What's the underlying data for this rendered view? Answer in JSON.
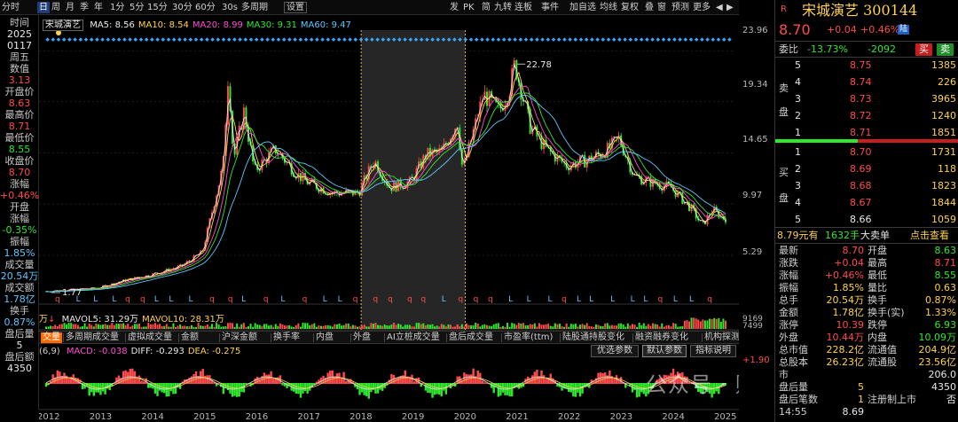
{
  "toolbar": {
    "left_items": [
      "分时",
      "日",
      "周",
      "月",
      "季",
      "年",
      "1分",
      "5分",
      "15分",
      "30分",
      "60分",
      "30s",
      "多周期",
      "设置"
    ],
    "active": "日",
    "right_items": [
      "发",
      "PK",
      "简",
      "九转",
      "连板",
      "事件",
      "加自选",
      "均线",
      "复权",
      "叠",
      "窗",
      "预测",
      "更多",
      "◀",
      "▶"
    ]
  },
  "readout": {
    "rows": [
      {
        "label": "时间",
        "value": "2025"
      },
      {
        "label": "",
        "value": "0117"
      },
      {
        "label": "周五",
        "value": ""
      },
      {
        "label": "数值",
        "value": "3.13"
      },
      {
        "label": "开盘价",
        "value": "8.63"
      },
      {
        "label": "最高价",
        "value": "8.71"
      },
      {
        "label": "最低价",
        "value": "8.55"
      },
      {
        "label": "收盘价",
        "value": "8.70"
      },
      {
        "label": "涨幅",
        "value": "+0.46%"
      },
      {
        "label": "开盘",
        "value": ""
      },
      {
        "label": "涨幅",
        "value": "-0.35%"
      },
      {
        "label": "振幅",
        "value": "1.85%"
      },
      {
        "label": "成交量",
        "value": "20.54万"
      },
      {
        "label": "成交额",
        "value": "1.78亿"
      },
      {
        "label": "换手",
        "value": "0.87%"
      },
      {
        "label": "盘后量",
        "value": "5"
      },
      {
        "label": "盘后额",
        "value": "4350"
      }
    ]
  },
  "stock": {
    "name": "宋城演艺",
    "tag": "宋城演艺",
    "code": "300144",
    "price": "8.70",
    "change": "+0.04",
    "pct": "+0.46%",
    "badge": "陆",
    "flag": "R"
  },
  "ma_legend": [
    {
      "name": "MA5: 8.56",
      "color": "#e8e8e8"
    },
    {
      "name": "MA10: 8.54",
      "color": "#ffd24a"
    },
    {
      "name": "MA20: 8.99",
      "color": "#ff4bd2"
    },
    {
      "name": "MA30: 9.31",
      "color": "#2ee82e"
    },
    {
      "name": "MA60: 9.47",
      "color": "#5ec8ff"
    }
  ],
  "volume_legend": [
    {
      "name": "MAVOL5: 31.29万",
      "color": "#e8e8e8"
    },
    {
      "name": "MAVOL10: 28.31万",
      "color": "#ffd24a"
    }
  ],
  "volume_left_label": "万",
  "macd_left_label": "(6,9)",
  "macd_legend": [
    {
      "name": "MACD: -0.038",
      "color": "#ff4bd2"
    },
    {
      "name": "DIFF: -0.293",
      "color": "#e8e8e8"
    },
    {
      "name": "DEA: -0.275",
      "color": "#ffd24a"
    }
  ],
  "axis_right": [
    "23.96",
    "19.34",
    "14.65",
    "9.97",
    "5.29"
  ],
  "axis_volume": [
    "9169",
    "7499"
  ],
  "axis_macd": "+1.90",
  "annot_high": "22.78",
  "annot_low": "1.77",
  "x_years": [
    "2012",
    "2013",
    "2014",
    "2015",
    "2016",
    "2017",
    "2018",
    "2019",
    "2020",
    "2021",
    "2022",
    "2023",
    "2024",
    "2025"
  ],
  "indicator_tabs": [
    "交量",
    "多周期成交量",
    "虚拟成交量",
    "金额",
    "沪深金额",
    "换手率",
    "内盘",
    "外盘",
    "AI立桩成交量",
    "盘后成交量",
    "市盈率(ttm)",
    "陆股通持股变化",
    "融资融券变化",
    "机构探测器",
    "资金抄底"
  ],
  "macd_buttons": [
    "优选参数",
    "默认参数",
    "指标说明"
  ],
  "order_book": {
    "weibi_label": "委比",
    "weibi": "-13.73%",
    "weicha": "-2092",
    "buy_btn": "买",
    "sell_btn": "卖",
    "sell_side_label": "卖",
    "sell_side_label2": "盘",
    "buy_side_label": "买",
    "buy_side_label2": "盘",
    "sells": [
      {
        "lvl": "5",
        "price": "8.75",
        "vol": "1385"
      },
      {
        "lvl": "4",
        "price": "8.74",
        "vol": "226"
      },
      {
        "lvl": "3",
        "price": "8.73",
        "vol": "3965"
      },
      {
        "lvl": "2",
        "price": "8.72",
        "vol": "1240"
      },
      {
        "lvl": "1",
        "price": "8.71",
        "vol": "1851"
      }
    ],
    "buys": [
      {
        "lvl": "1",
        "price": "8.70",
        "vol": "1731"
      },
      {
        "lvl": "2",
        "price": "8.69",
        "vol": "118"
      },
      {
        "lvl": "3",
        "price": "8.68",
        "vol": "1823"
      },
      {
        "lvl": "4",
        "price": "8.67",
        "vol": "1844"
      },
      {
        "lvl": "5",
        "price": "8.66",
        "vol": "1059"
      }
    ]
  },
  "big_order": {
    "price": "8.79元有",
    "vol": "1632手",
    "label": "大卖单",
    "link": "点击查看"
  },
  "quote": [
    {
      "l1": "最新",
      "v1": "8.70",
      "c1": "up",
      "l2": "开盘",
      "v2": "8.63",
      "c2": "dn"
    },
    {
      "l1": "涨跌",
      "v1": "+0.04",
      "c1": "up",
      "l2": "最高",
      "v2": "8.71",
      "c2": "up"
    },
    {
      "l1": "涨幅",
      "v1": "+0.46%",
      "c1": "up",
      "l2": "最低",
      "v2": "8.55",
      "c2": "dn"
    },
    {
      "l1": "振幅",
      "v1": "1.85%",
      "c1": "yl",
      "l2": "量比",
      "v2": "0.63",
      "c2": "yl"
    },
    {
      "l1": "总手",
      "v1": "20.54万",
      "c1": "yl",
      "l2": "换手",
      "v2": "0.87%",
      "c2": "yl"
    },
    {
      "l1": "金额",
      "v1": "1.78亿",
      "c1": "yl",
      "l2": "换手(实)",
      "v2": "1.33%",
      "c2": "yl"
    },
    {
      "l1": "涨停",
      "v1": "10.39",
      "c1": "up",
      "l2": "跌停",
      "v2": "6.93",
      "c2": "dn"
    },
    {
      "l1": "外盘",
      "v1": "10.44万",
      "c1": "up",
      "l2": "内盘",
      "v2": "10.09万",
      "c2": "dn"
    },
    {
      "l1": "总市值",
      "v1": "228.2亿",
      "c1": "yl",
      "l2": "流通值",
      "v2": "204.9亿",
      "c2": "yl"
    },
    {
      "l1": "总股本",
      "v1": "26.23亿",
      "c1": "yl",
      "l2": "流通股",
      "v2": "23.56亿",
      "c2": "yl"
    },
    {
      "l1": "市",
      "v1": "",
      "c1": "yl",
      "l2": "",
      "v2": "206.0",
      "c2": "wh"
    },
    {
      "l1": "盘后量",
      "v1": "5",
      "c1": "yl",
      "l2": "",
      "v2": "4350",
      "c2": "wh"
    },
    {
      "l1": "盘后笔数",
      "v1": "1",
      "c1": "yl",
      "l2": "注册制上市",
      "v2": "否",
      "c2": "wh"
    },
    {
      "l1": "14:55",
      "v1": "8.69",
      "c1": "wh",
      "l2": "",
      "v2": "",
      "c2": "wh"
    }
  ],
  "watermark": "公众号 · 财富独角兽",
  "chart_data": {
    "type": "candlestick",
    "title": "宋城演艺 300144 日K",
    "x_range": [
      "2012",
      "2025"
    ],
    "y_range": [
      1.77,
      23.96
    ],
    "series": [
      {
        "name": "close",
        "points": [
          [
            "2012",
            2.0
          ],
          [
            "2013",
            2.3
          ],
          [
            "2013.5",
            3.0
          ],
          [
            "2014",
            3.5
          ],
          [
            "2014.6",
            4.3
          ],
          [
            "2015",
            5.6
          ],
          [
            "2015.4",
            13.5
          ],
          [
            "2015.5",
            22.2
          ],
          [
            "2015.6",
            14.0
          ],
          [
            "2015.8",
            18.5
          ],
          [
            "2016",
            13.0
          ],
          [
            "2016.4",
            15.0
          ],
          [
            "2016.8",
            12.8
          ],
          [
            "2017",
            12.0
          ],
          [
            "2017.5",
            11.0
          ],
          [
            "2018",
            11.0
          ],
          [
            "2018.3",
            14.0
          ],
          [
            "2018.6",
            11.5
          ],
          [
            "2019",
            12.0
          ],
          [
            "2019.3",
            14.5
          ],
          [
            "2019.6",
            14.8
          ],
          [
            "2019.9",
            17.5
          ],
          [
            "2020",
            13.0
          ],
          [
            "2020.4",
            20.0
          ],
          [
            "2020.7",
            18.5
          ],
          [
            "2020.9",
            20.5
          ],
          [
            "2021",
            22.8
          ],
          [
            "2021.3",
            17.0
          ],
          [
            "2021.6",
            15.0
          ],
          [
            "2022",
            13.5
          ],
          [
            "2022.4",
            14.0
          ],
          [
            "2022.8",
            15.0
          ],
          [
            "2023",
            16.0
          ],
          [
            "2023.3",
            12.5
          ],
          [
            "2023.6",
            12.0
          ],
          [
            "2024",
            11.5
          ],
          [
            "2024.4",
            9.5
          ],
          [
            "2024.6",
            8.0
          ],
          [
            "2024.8",
            9.5
          ],
          [
            "2025",
            8.7
          ]
        ]
      }
    ]
  }
}
